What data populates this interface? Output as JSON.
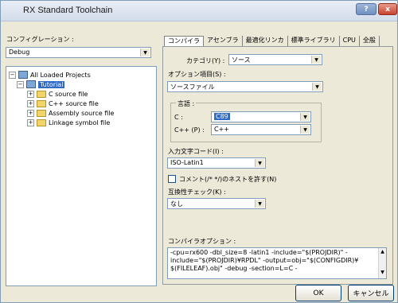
{
  "window": {
    "title": "RX Standard Toolchain",
    "help_button": "?",
    "close_button": "x"
  },
  "left": {
    "config_label": "コンフィグレーション :",
    "config_value": "Debug",
    "tree": {
      "root": "All Loaded Projects",
      "project": "Tutorial",
      "children": [
        "C source file",
        "C++ source file",
        "Assembly source file",
        "Linkage symbol file"
      ]
    }
  },
  "tabs": [
    "コンパイラ",
    "アセンブラ",
    "最適化リンカ",
    "標準ライブラリ",
    "CPU",
    "全般"
  ],
  "compiler": {
    "category_label": "カテゴリ(Y) :",
    "category_value": "ソース",
    "option_item_label": "オプション項目(S) :",
    "option_item_value": "ソースファイル",
    "language_group_label": "言語 :",
    "c_label": "C :",
    "c_value": "C89",
    "cpp_label": "C++ (P) :",
    "cpp_value": "C++",
    "input_charset_label": "入力文字コード(I) :",
    "input_charset_value": "ISO-Latin1",
    "nested_comment_label": "コメント(/* */)のネストを許す(N)",
    "compat_label": "互換性チェック(K) :",
    "compat_value": "なし",
    "compiler_options_label": "コンパイラオプション :",
    "compiler_options_lines": [
      "-cpu=rx600 -dbl_size=8 -latin1 -include=\"$(PROJDIR)\" -",
      "include=\"$(PROJDIR)¥RPDL\" -output=obj=\"$(CONFIGDIR)¥",
      "$(FILELEAF).obj\" -debug -section=L=C -"
    ]
  },
  "buttons": {
    "ok": "OK",
    "cancel": "キャンセル"
  }
}
